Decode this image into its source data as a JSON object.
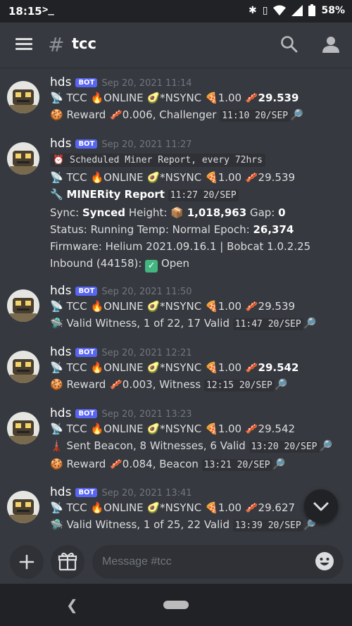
{
  "status_bar": {
    "time": "18:15",
    "terminal": ">_",
    "battery": "58%"
  },
  "header": {
    "channel_name": "tcc"
  },
  "composer": {
    "placeholder": "Message #tcc"
  },
  "messages": [
    {
      "author": "hds",
      "badge": "BOT",
      "timestamp": "Sep 20, 2021 11:14",
      "line1": {
        "a": " TCC ",
        "b": "ONLINE ",
        "c": "*NSYNC ",
        "d": "1.00 ",
        "e": "29.539"
      },
      "line2": {
        "text": " Reward ",
        "val": "0.006, Challenger ",
        "code": "11:10 20/SEP"
      }
    },
    {
      "author": "hds",
      "badge": "BOT",
      "timestamp": "Sep 20, 2021 11:27",
      "header_code": "⏰ Scheduled Miner Report, every 72hrs",
      "line1": {
        "a": " TCC ",
        "b": "ONLINE ",
        "c": "*NSYNC ",
        "d": "1.00 ",
        "e": "29.539"
      },
      "report": {
        "title": "MINERity Report",
        "code": "11:27 20/SEP"
      },
      "sync": {
        "label": "Sync: ",
        "value": "Synced",
        "height_label": "  Height: ",
        "height": "1,018,963",
        "gap_label": "  Gap: ",
        "gap": "0"
      },
      "status": {
        "label": "Status: Running  Temp: Normal  Epoch: ",
        "epoch": "26,374"
      },
      "firmware": "Firmware: Helium 2021.09.16.1 | Bobcat 1.0.2.25",
      "inbound": {
        "label": "Inbound (44158): ",
        "value": " Open"
      }
    },
    {
      "author": "hds",
      "badge": "BOT",
      "timestamp": "Sep 20, 2021 11:50",
      "line1": {
        "a": " TCC ",
        "b": "ONLINE ",
        "c": "*NSYNC ",
        "d": "1.00 ",
        "e": "29.539"
      },
      "line2": {
        "text": " Valid Witness, 1 of 22, 17 Valid ",
        "code": "11:47 20/SEP"
      }
    },
    {
      "author": "hds",
      "badge": "BOT",
      "timestamp": "Sep 20, 2021 12:21",
      "line1": {
        "a": " TCC ",
        "b": "ONLINE ",
        "c": "*NSYNC ",
        "d": "1.00 ",
        "e": "29.542"
      },
      "line2": {
        "text": " Reward ",
        "val": "0.003, Witness ",
        "code": "12:15 20/SEP"
      }
    },
    {
      "author": "hds",
      "badge": "BOT",
      "timestamp": "Sep 20, 2021 13:23",
      "line1": {
        "a": " TCC ",
        "b": "ONLINE ",
        "c": "*NSYNC ",
        "d": "1.00 ",
        "e": "29.542"
      },
      "line2": {
        "text": " Sent Beacon, 8 Witnesses, 6 Valid ",
        "code": "13:20 20/SEP"
      },
      "line3": {
        "text": " Reward ",
        "val": "0.084, Beacon ",
        "code": "13:21 20/SEP"
      }
    },
    {
      "author": "hds",
      "badge": "BOT",
      "timestamp": "Sep 20, 2021 13:41",
      "line1": {
        "a": " TCC ",
        "b": "ONLINE ",
        "c": "*NSYNC ",
        "d": "1.00 ",
        "e": "29.627"
      },
      "line2": {
        "text": " Valid Witness, 1 of 25, 22 Valid ",
        "code": "13:39 20/SEP"
      }
    }
  ]
}
